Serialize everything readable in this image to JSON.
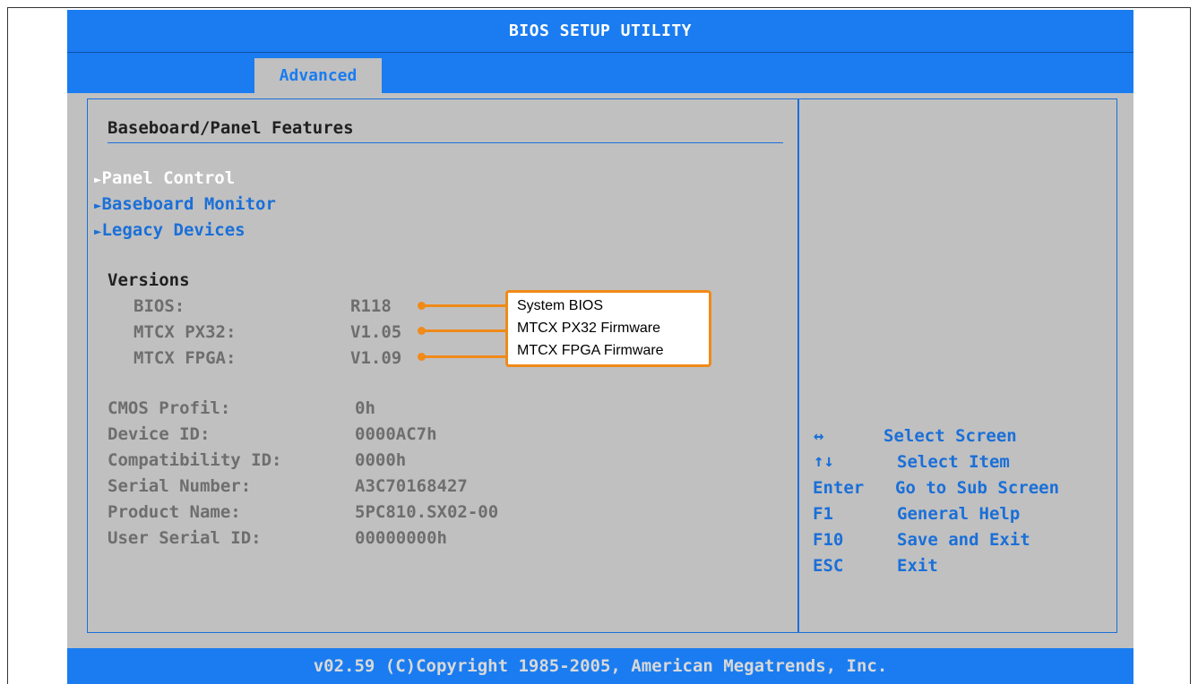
{
  "title": "BIOS SETUP UTILITY",
  "tabs": [
    {
      "label": "Advanced",
      "active": true
    }
  ],
  "section_heading": "Baseboard/Panel Features",
  "submenus": [
    {
      "label": "Panel Control",
      "selected": true
    },
    {
      "label": "Baseboard Monitor",
      "selected": false
    },
    {
      "label": "Legacy Devices",
      "selected": false
    }
  ],
  "submenu_marker": "►",
  "versions": {
    "heading": "Versions",
    "items": [
      {
        "label": "BIOS:",
        "value": "R118"
      },
      {
        "label": "MTCX PX32:",
        "value": "V1.05"
      },
      {
        "label": "MTCX FPGA:",
        "value": "V1.09"
      }
    ]
  },
  "info": [
    {
      "label": "CMOS Profil:",
      "value": "0h"
    },
    {
      "label": "Device ID:",
      "value": "0000AC7h"
    },
    {
      "label": "Compatibility ID:",
      "value": "0000h"
    },
    {
      "label": "Serial Number:",
      "value": "A3C70168427"
    },
    {
      "label": "Product Name:",
      "value": "5PC810.SX02-00"
    },
    {
      "label": "User Serial ID:",
      "value": "00000000h"
    }
  ],
  "callouts": [
    "System BIOS",
    "MTCX PX32 Firmware",
    "MTCX FPGA Firmware"
  ],
  "help": [
    {
      "key": "↔",
      "text": "Select Screen"
    },
    {
      "key": "↑↓",
      "text": "Select Item"
    },
    {
      "key": "Enter",
      "text": "Go to Sub Screen"
    },
    {
      "key": "F1",
      "text": "General Help"
    },
    {
      "key": "F10",
      "text": "Save and Exit"
    },
    {
      "key": "ESC",
      "text": "Exit"
    }
  ],
  "footer": "v02.59 (C)Copyright 1985-2005, American Megatrends, Inc.",
  "colors": {
    "accent": "#1a7cf0",
    "background": "#c0c0c0",
    "callout_border": "#f08a18"
  }
}
